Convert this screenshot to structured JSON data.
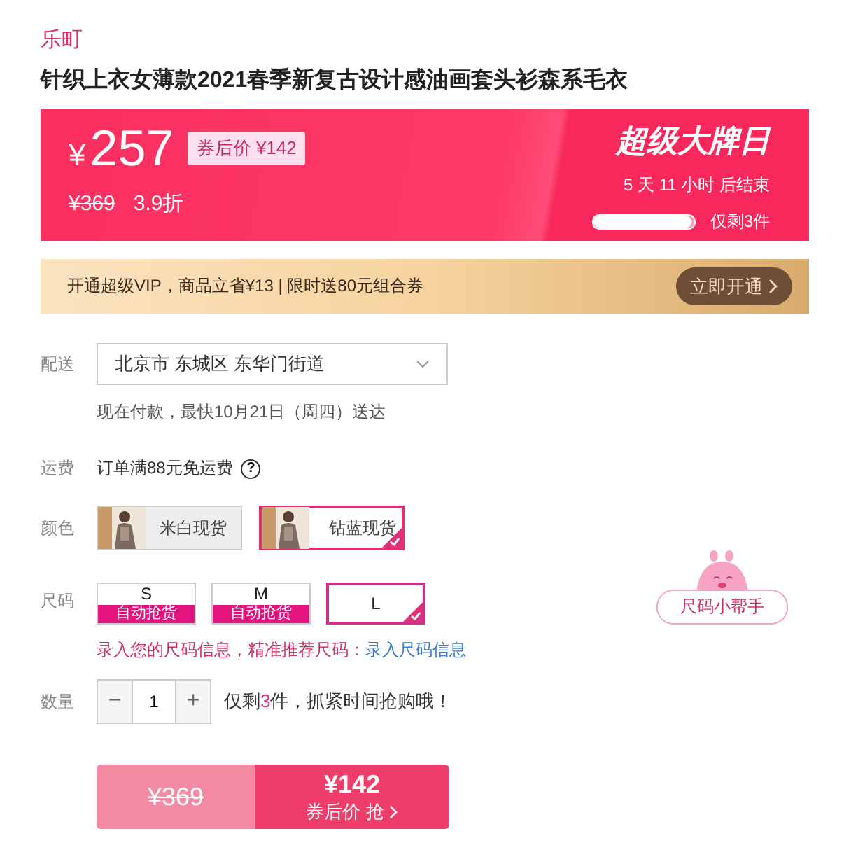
{
  "brand": "乐町",
  "title": "针织上衣女薄款2021春季新复古设计感油画套头衫森系毛衣",
  "promo": {
    "currency": "¥",
    "price": "257",
    "coupon_price": "券后价 ¥142",
    "original_price": "¥369",
    "discount": "3.9折",
    "event": "超级大牌日",
    "countdown": "5  天 11 小时 后结束",
    "stock": {
      "level": 0.97,
      "text": "仅剩3件"
    }
  },
  "vip": {
    "text": "开通超级VIP，商品立省¥13 | 限时送80元组合券",
    "button": "立即开通"
  },
  "delivery": {
    "label": "配送",
    "address": "北京市 东城区 东华门街道",
    "note": "现在付款，最快10月21日（周四）送达"
  },
  "shipping": {
    "label": "运费",
    "text": "订单满88元免运费",
    "help": "?"
  },
  "colors": {
    "label": "颜色",
    "options": [
      {
        "name": "米白现货",
        "selected": false
      },
      {
        "name": "钻蓝现货",
        "selected": true
      }
    ]
  },
  "sizes": {
    "label": "尺码",
    "options": [
      {
        "name": "S",
        "badge": "自动抢货",
        "selected": false
      },
      {
        "name": "M",
        "badge": "自动抢货",
        "selected": false
      },
      {
        "name": "L",
        "selected": true
      }
    ],
    "helper": "尺码小帮手",
    "hint": "录入您的尺码信息，精准推荐尺码：",
    "hint_link": "录入尺码信息"
  },
  "quantity": {
    "label": "数量",
    "minus": "−",
    "value": "1",
    "plus": "+",
    "stock_before": "仅剩",
    "stock_count": "3",
    "stock_after": "件，抓紧时间抢购哦！"
  },
  "buy": {
    "original_price": "¥369",
    "price": "¥142",
    "action": "券后价 抢"
  }
}
